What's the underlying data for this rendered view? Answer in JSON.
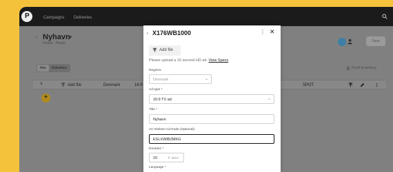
{
  "nav": {
    "logo": "P",
    "campaigns": "Campaigns",
    "deliveries": "Deliveries"
  },
  "page": {
    "title": "Nyhavn",
    "subtitle": "Peach - Peach",
    "save_label": "Save",
    "tabs": [
      "Ads",
      "Deliveries"
    ],
    "proof_label": "Proof of delivery"
  },
  "row": {
    "add_file": "Add file",
    "country": "Denmark",
    "format": "16:9 TV ad",
    "spot": "SPOT"
  },
  "fab_label": "+",
  "modal": {
    "title": "X176WB1000",
    "add_file_label": "Add file",
    "hint": "Please upload a 10 second HD ad.",
    "view_specs": "View Specs",
    "regions_label": "Regions",
    "regions_value": "Denmark",
    "ad_type_label": "Ad type *",
    "ad_type_value": "16:9 TV ad",
    "title_label": "Title *",
    "title_value": "Nyhavn",
    "ac_label": "AC Nielsen Ad-Kode (Optional)",
    "ac_value": "ESLXWIBZMKG",
    "duration_label": "Duration *",
    "duration_value": "10",
    "duration_unit": "secs",
    "language_label": "Language *"
  },
  "icons": {
    "search": "search-icon",
    "edit": "pencil-icon",
    "close": "close-icon",
    "more": "kebab-icon",
    "upload": "upload-icon",
    "download": "download-icon"
  },
  "colors": {
    "background": "#f5c33b",
    "topbar": "#1b1b1b",
    "accent": "#b08a1d"
  }
}
